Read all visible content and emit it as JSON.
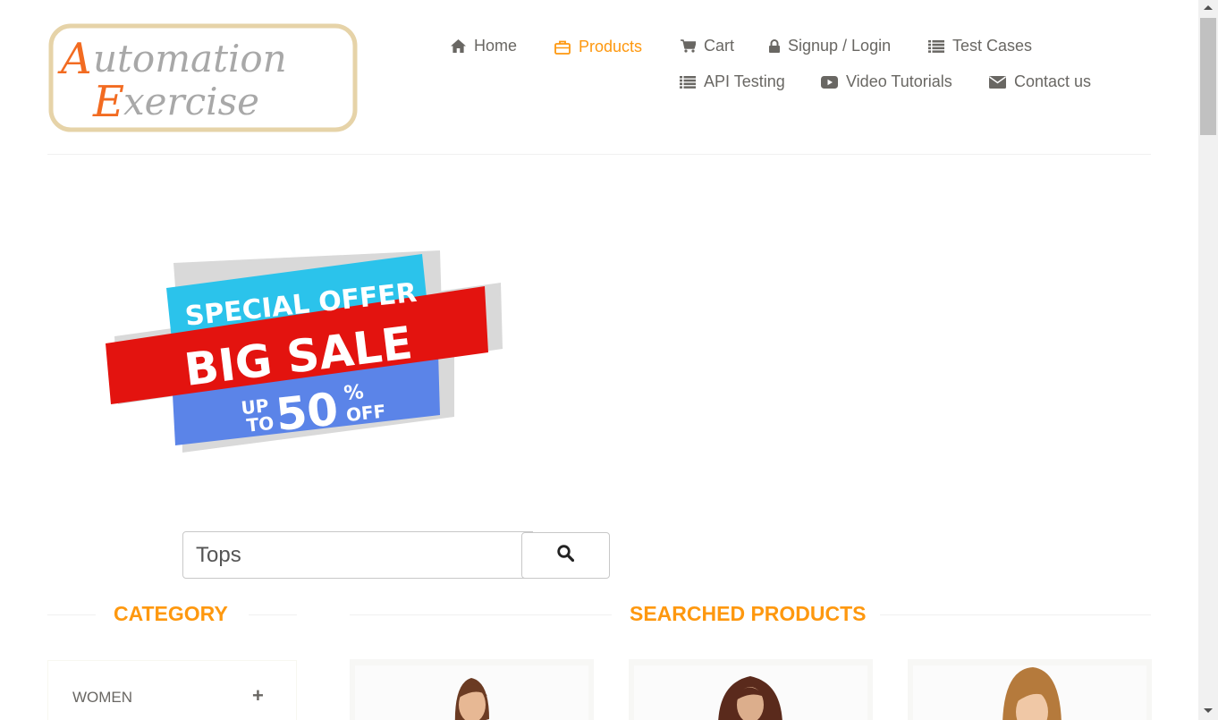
{
  "logo": {
    "line1": "Automation",
    "line2": "Exercise"
  },
  "nav": [
    {
      "label": "Home",
      "icon": "home-icon"
    },
    {
      "label": "Products",
      "icon": "briefcase-icon",
      "active": true
    },
    {
      "label": "Cart",
      "icon": "cart-icon"
    },
    {
      "label": "Signup / Login",
      "icon": "lock-icon"
    },
    {
      "label": "Test Cases",
      "icon": "list-icon"
    },
    {
      "label": "API Testing",
      "icon": "list-icon"
    },
    {
      "label": "Video Tutorials",
      "icon": "youtube-play-icon"
    },
    {
      "label": "Contact us",
      "icon": "envelope-icon"
    }
  ],
  "banner": {
    "line1": "SPECIAL OFFER",
    "line2": "BIG SALE",
    "up": "UP",
    "to": "TO",
    "amount": "50",
    "percent": "%",
    "off": "OFF"
  },
  "search": {
    "value": "Tops",
    "button_icon": "search-icon"
  },
  "sections": {
    "category": "CATEGORY",
    "searched": "SEARCHED PRODUCTS"
  },
  "categories": [
    {
      "label": "WOMEN",
      "icon": "plus-icon"
    }
  ],
  "colors": {
    "accent": "#FE980F",
    "text": "#696763",
    "banner_cyan": "#2BC3EB",
    "banner_red": "#E3130F",
    "banner_blue": "#5B84E8"
  }
}
